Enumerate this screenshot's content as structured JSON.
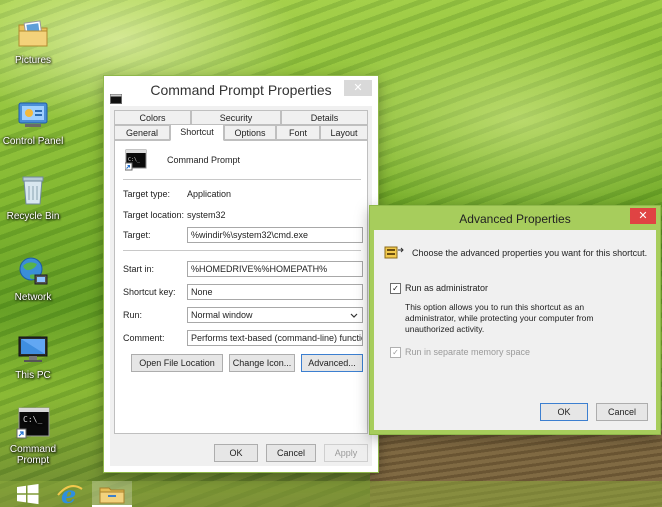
{
  "desktop": {
    "icons": [
      {
        "label": "Pictures",
        "icon": "pictures-folder-icon"
      },
      {
        "label": "Control Panel",
        "icon": "control-panel-icon"
      },
      {
        "label": "Recycle Bin",
        "icon": "recycle-bin-icon"
      },
      {
        "label": "Network",
        "icon": "network-icon"
      },
      {
        "label": "This PC",
        "icon": "this-pc-icon"
      },
      {
        "label": "Command Prompt",
        "icon": "command-prompt-icon"
      }
    ]
  },
  "taskbar": {
    "items": [
      "start-button-icon",
      "internet-explorer-icon",
      "file-explorer-icon"
    ]
  },
  "props_dialog": {
    "title": "Command Prompt Properties",
    "close_glyph": "✕",
    "tabs_top": [
      "Colors",
      "Security",
      "Details"
    ],
    "tabs_bottom": [
      "General",
      "Shortcut",
      "Options",
      "Font",
      "Layout"
    ],
    "active_tab": "Shortcut",
    "app_name": "Command Prompt",
    "target_type_label": "Target type:",
    "target_type_value": "Application",
    "target_location_label": "Target location:",
    "target_location_value": "system32",
    "target_label": "Target:",
    "target_value": "%windir%\\system32\\cmd.exe",
    "start_in_label": "Start in:",
    "start_in_value": "%HOMEDRIVE%%HOMEPATH%",
    "shortcut_key_label": "Shortcut key:",
    "shortcut_key_value": "None",
    "run_label": "Run:",
    "run_value": "Normal window",
    "comment_label": "Comment:",
    "comment_value": "Performs text-based (command-line) functions.",
    "open_file_location": "Open File Location",
    "change_icon": "Change Icon...",
    "advanced": "Advanced...",
    "ok": "OK",
    "cancel": "Cancel",
    "apply": "Apply"
  },
  "advanced_dialog": {
    "title": "Advanced Properties",
    "close_glyph": "✕",
    "description": "Choose the advanced properties you want for this shortcut.",
    "run_as_admin_label": "Run as administrator",
    "run_as_admin_checked": true,
    "admin_note": "This option allows you to run this shortcut as an administrator, while protecting your computer from unauthorized activity.",
    "separate_memory_label": "Run in separate memory space",
    "separate_memory_checked": true,
    "ok": "OK",
    "cancel": "Cancel",
    "colors": {
      "close_button": "#e04343",
      "frame": "#8fb84a"
    }
  }
}
